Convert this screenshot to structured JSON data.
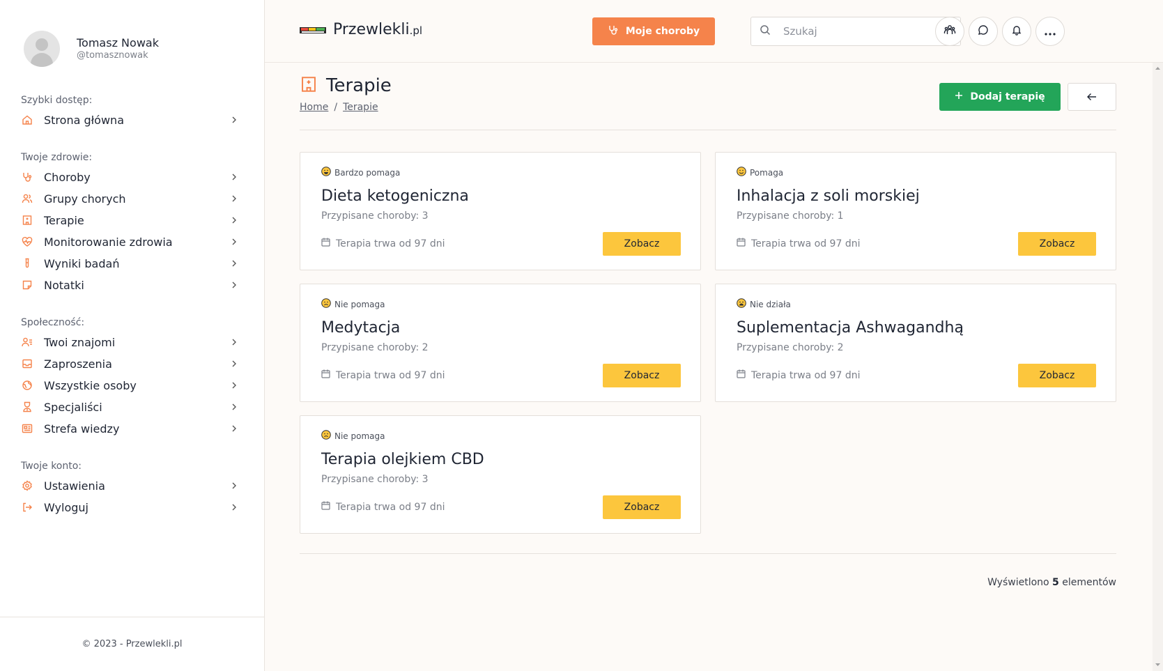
{
  "user": {
    "name": "Tomasz Nowak",
    "handle": "@tomasznowak"
  },
  "sidebar": {
    "sections": [
      {
        "label": "Szybki dostęp:",
        "items": [
          {
            "label": "Strona główna",
            "icon": "home-icon"
          }
        ]
      },
      {
        "label": "Twoje zdrowie:",
        "items": [
          {
            "label": "Choroby",
            "icon": "stethoscope-icon"
          },
          {
            "label": "Grupy chorych",
            "icon": "users-icon"
          },
          {
            "label": "Terapie",
            "icon": "hospital-icon"
          },
          {
            "label": "Monitorowanie zdrowia",
            "icon": "heart-pulse-icon"
          },
          {
            "label": "Wyniki badań",
            "icon": "test-tube-icon"
          },
          {
            "label": "Notatki",
            "icon": "note-icon"
          }
        ]
      },
      {
        "label": "Społeczność:",
        "items": [
          {
            "label": "Twoi znajomi",
            "icon": "user-list-icon"
          },
          {
            "label": "Zaproszenia",
            "icon": "inbox-icon"
          },
          {
            "label": "Wszystkie osoby",
            "icon": "globe-icon"
          },
          {
            "label": "Specjaliści",
            "icon": "doctor-icon"
          },
          {
            "label": "Strefa wiedzy",
            "icon": "newspaper-icon"
          }
        ]
      },
      {
        "label": "Twoje konto:",
        "items": [
          {
            "label": "Ustawienia",
            "icon": "gear-icon"
          },
          {
            "label": "Wyloguj",
            "icon": "logout-icon"
          }
        ]
      }
    ],
    "footer": "© 2023 - Przewlekli.pl"
  },
  "header": {
    "logo_main": "Przewlekli",
    "logo_suffix": ".pl",
    "choroby_button": "Moje choroby",
    "search_placeholder": "Szukaj"
  },
  "page": {
    "title": "Terapie",
    "breadcrumb": {
      "home": "Home",
      "current": "Terapie"
    },
    "add_button": "Dodaj terapię"
  },
  "therapies": [
    {
      "status": "Bardzo pomaga",
      "title": "Dieta ketogeniczna",
      "assigned": "Przypisane choroby: 3",
      "duration": "Terapia trwa od 97 dni",
      "button": "Zobacz"
    },
    {
      "status": "Pomaga",
      "title": "Inhalacja z soli morskiej",
      "assigned": "Przypisane choroby: 1",
      "duration": "Terapia trwa od 97 dni",
      "button": "Zobacz"
    },
    {
      "status": "Nie pomaga",
      "title": "Medytacja",
      "assigned": "Przypisane choroby: 2",
      "duration": "Terapia trwa od 97 dni",
      "button": "Zobacz"
    },
    {
      "status": "Nie działa",
      "title": "Suplementacja Ashwagandhą",
      "assigned": "Przypisane choroby: 2",
      "duration": "Terapia trwa od 97 dni",
      "button": "Zobacz"
    },
    {
      "status": "Nie pomaga",
      "title": "Terapia olejkiem CBD",
      "assigned": "Przypisane choroby: 3",
      "duration": "Terapia trwa od 97 dni",
      "button": "Zobacz"
    }
  ],
  "footer_count": {
    "prefix": "Wyświetlono",
    "count": "5",
    "suffix": "elementów"
  },
  "colors": {
    "accent_orange": "#f5834b",
    "green": "#23a559",
    "yellow": "#fcc63d"
  }
}
